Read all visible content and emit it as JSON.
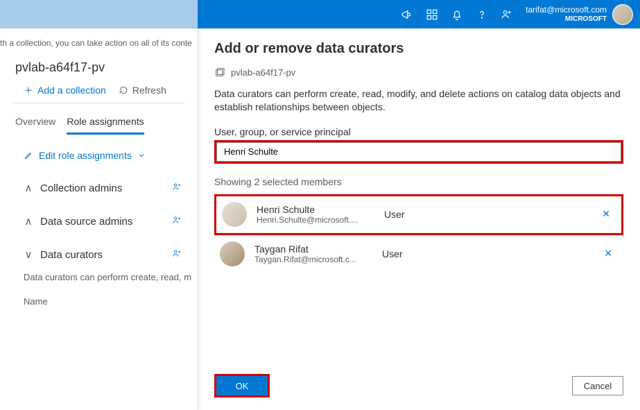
{
  "user": {
    "email": "tarifat@microsoft.com",
    "org": "MICROSOFT"
  },
  "left": {
    "hint": "th a collection, you can take action on all of its conte",
    "collectionName": "pvlab-a64f17-pv",
    "addLabel": "Add a collection",
    "refreshLabel": "Refresh",
    "tabs": {
      "overview": "Overview",
      "roleAssignments": "Role assignments"
    },
    "editRoles": "Edit role assignments",
    "sections": {
      "collectionAdmins": "Collection admins",
      "dataSourceAdmins": "Data source admins",
      "dataCurators": "Data curators"
    },
    "dataCuratorsDesc": "Data curators can perform create, read, m",
    "nameHeader": "Name"
  },
  "panel": {
    "title": "Add or remove data curators",
    "context": "pvlab-a64f17-pv",
    "desc": "Data curators can perform create, read, modify, and delete actions on catalog data objects and establish relationships between objects.",
    "fieldLabel": "User, group, or service principal",
    "searchValue": "Henri Schulte",
    "summary": "Showing 2 selected members",
    "members": [
      {
        "name": "Henri Schulte",
        "sub": "Henri.Schulte@microsoft....",
        "type": "User"
      },
      {
        "name": "Taygan Rifat",
        "sub": "Taygan.Rifat@microsoft.c...",
        "type": "User"
      }
    ],
    "ok": "OK",
    "cancel": "Cancel"
  }
}
